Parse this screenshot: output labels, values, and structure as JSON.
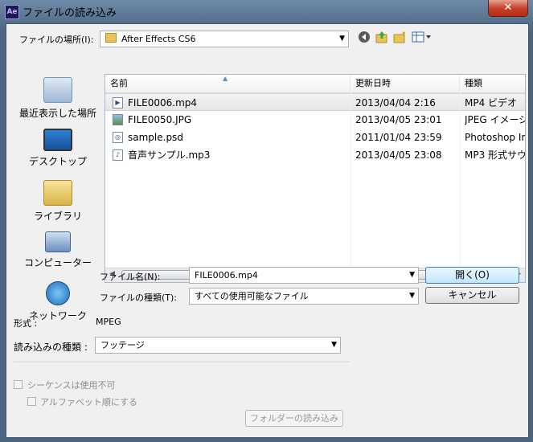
{
  "window": {
    "app_icon_text": "Ae",
    "title": "ファイルの読み込み",
    "close_label": "✕"
  },
  "location": {
    "label": "ファイルの場所(I):",
    "value": "After Effects CS6"
  },
  "toolbar": {
    "icons": [
      "back-icon",
      "up-folder-icon",
      "new-folder-icon",
      "view-menu-icon"
    ]
  },
  "places": [
    {
      "label": "最近表示した場所",
      "icon": "recent-places-icon"
    },
    {
      "label": "デスクトップ",
      "icon": "desktop-icon"
    },
    {
      "label": "ライブラリ",
      "icon": "library-icon"
    },
    {
      "label": "コンピューター",
      "icon": "computer-icon"
    },
    {
      "label": "ネットワーク",
      "icon": "network-icon"
    }
  ],
  "columns": [
    "名前",
    "更新日時",
    "種類"
  ],
  "files": [
    {
      "name": "FILE0006.mp4",
      "date": "2013/04/04 2:16",
      "type": "MP4 ビデオ",
      "selected": true
    },
    {
      "name": "FILE0050.JPG",
      "date": "2013/04/05 23:01",
      "type": "JPEG イメージ",
      "selected": false
    },
    {
      "name": "sample.psd",
      "date": "2011/01/04 23:59",
      "type": "Photoshop Im",
      "selected": false
    },
    {
      "name": "音声サンプル.mp3",
      "date": "2013/04/05 23:08",
      "type": "MP3 形式サウ",
      "selected": false
    }
  ],
  "scroll_thumb": "III",
  "filename": {
    "label": "ファイル名(N):",
    "value": "FILE0006.mp4"
  },
  "filetype": {
    "label": "ファイルの種類(T):",
    "value": "すべての使用可能なファイル"
  },
  "buttons": {
    "open": "開く(O)",
    "cancel": "キャンセル",
    "import_folder": "フォルダーの読み込み"
  },
  "format": {
    "label": "形式 :",
    "value": "MPEG"
  },
  "import_as": {
    "label": "読み込みの種類 :",
    "value": "フッテージ"
  },
  "sequence_label": "シーケンスは使用不可",
  "alpha_label": "アルファベット順にする"
}
